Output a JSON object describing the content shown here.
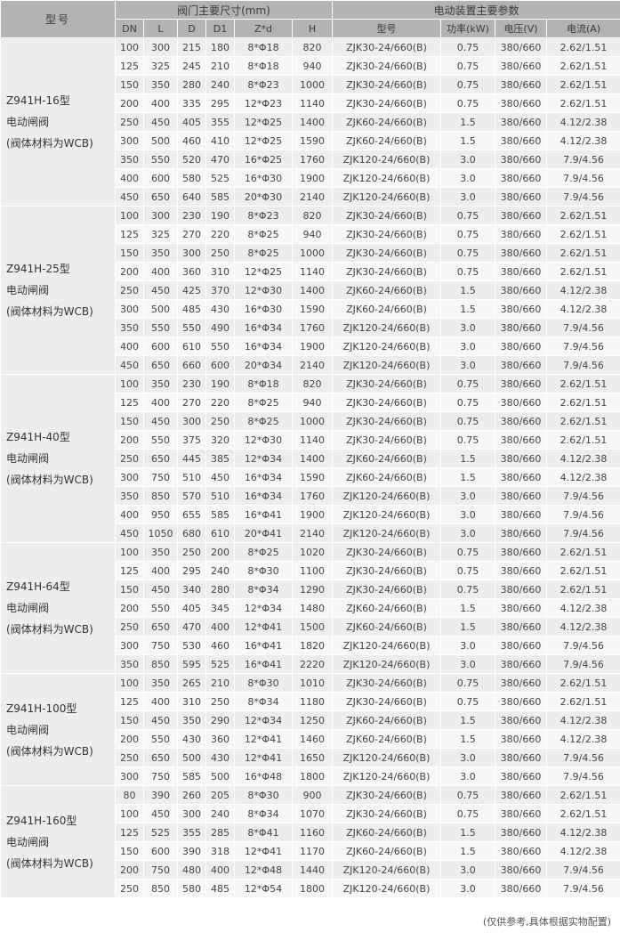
{
  "headers": {
    "model": "型号",
    "valve_group": "阀门主要尺寸(mm)",
    "actuator_group": "电动装置主要参数",
    "valve_cols": [
      "DN",
      "L",
      "D",
      "D1",
      "Z*d",
      "H"
    ],
    "actuator_cols": [
      "型号",
      "功率(kW)",
      "电压(V)",
      "电流(A)"
    ]
  },
  "groups": [
    {
      "model_lines": [
        "Z941H-16型",
        "电动闸阀",
        "(阀体材料为WCB)"
      ],
      "rows": [
        [
          "100",
          "300",
          "215",
          "180",
          "8*Φ18",
          "820",
          "ZJK30-24/660(B)",
          "0.75",
          "380/660",
          "2.62/1.51"
        ],
        [
          "125",
          "325",
          "245",
          "210",
          "8*Φ18",
          "940",
          "ZJK30-24/660(B)",
          "0.75",
          "380/660",
          "2.62/1.51"
        ],
        [
          "150",
          "350",
          "280",
          "240",
          "8*Φ23",
          "1000",
          "ZJK30-24/660(B)",
          "0.75",
          "380/660",
          "2.62/1.51"
        ],
        [
          "200",
          "400",
          "335",
          "295",
          "12*Φ23",
          "1140",
          "ZJK30-24/660(B)",
          "0.75",
          "380/660",
          "2.62/1.51"
        ],
        [
          "250",
          "450",
          "405",
          "355",
          "12*Φ25",
          "1400",
          "ZJK60-24/660(B)",
          "1.5",
          "380/660",
          "4.12/2.38"
        ],
        [
          "300",
          "500",
          "460",
          "410",
          "12*Φ25",
          "1590",
          "ZJK60-24/660(B)",
          "1.5",
          "380/660",
          "4.12/2.38"
        ],
        [
          "350",
          "550",
          "520",
          "470",
          "16*Φ25",
          "1760",
          "ZJK120-24/660(B)",
          "3.0",
          "380/660",
          "7.9/4.56"
        ],
        [
          "400",
          "600",
          "580",
          "525",
          "16*Φ30",
          "1900",
          "ZJK120-24/660(B)",
          "3.0",
          "380/660",
          "7.9/4.56"
        ],
        [
          "450",
          "650",
          "640",
          "585",
          "20*Φ30",
          "2140",
          "ZJK120-24/660(B)",
          "3.0",
          "380/660",
          "7.9/4.56"
        ]
      ]
    },
    {
      "model_lines": [
        "Z941H-25型",
        "电动闸阀",
        "(阀体材料为WCB)"
      ],
      "rows": [
        [
          "100",
          "300",
          "230",
          "190",
          "8*Φ23",
          "820",
          "ZJK30-24/660(B)",
          "0.75",
          "380/660",
          "2.62/1.51"
        ],
        [
          "125",
          "325",
          "270",
          "220",
          "8*Φ25",
          "940",
          "ZJK30-24/660(B)",
          "0.75",
          "380/660",
          "2.62/1.51"
        ],
        [
          "150",
          "350",
          "300",
          "250",
          "8*Φ25",
          "1000",
          "ZJK30-24/660(B)",
          "0.75",
          "380/660",
          "2.62/1.51"
        ],
        [
          "200",
          "400",
          "360",
          "310",
          "12*Φ25",
          "1140",
          "ZJK30-24/660(B)",
          "0.75",
          "380/660",
          "2.62/1.51"
        ],
        [
          "250",
          "450",
          "425",
          "370",
          "12*Φ30",
          "1400",
          "ZJK60-24/660(B)",
          "1.5",
          "380/660",
          "4.12/2.38"
        ],
        [
          "300",
          "500",
          "485",
          "430",
          "16*Φ30",
          "1590",
          "ZJK60-24/660(B)",
          "1.5",
          "380/660",
          "4.12/2.38"
        ],
        [
          "350",
          "550",
          "550",
          "490",
          "16*Φ34",
          "1760",
          "ZJK120-24/660(B)",
          "3.0",
          "380/660",
          "7.9/4.56"
        ],
        [
          "400",
          "600",
          "610",
          "550",
          "16*Φ34",
          "1900",
          "ZJK120-24/660(B)",
          "3.0",
          "380/660",
          "7.9/4.56"
        ],
        [
          "450",
          "650",
          "660",
          "600",
          "20*Φ34",
          "2140",
          "ZJK120-24/660(B)",
          "3.0",
          "380/660",
          "7.9/4.56"
        ]
      ]
    },
    {
      "model_lines": [
        "Z941H-40型",
        "电动闸阀",
        "(阀体材料为WCB)"
      ],
      "rows": [
        [
          "100",
          "350",
          "230",
          "190",
          "8*Φ18",
          "820",
          "ZJK30-24/660(B)",
          "0.75",
          "380/660",
          "2.62/1.51"
        ],
        [
          "125",
          "400",
          "270",
          "220",
          "8*Φ25",
          "940",
          "ZJK30-24/660(B)",
          "0.75",
          "380/660",
          "2.62/1.51"
        ],
        [
          "150",
          "450",
          "300",
          "250",
          "8*Φ25",
          "1000",
          "ZJK30-24/660(B)",
          "0.75",
          "380/660",
          "2.62/1.51"
        ],
        [
          "200",
          "550",
          "375",
          "320",
          "12*Φ30",
          "1140",
          "ZJK30-24/660(B)",
          "0.75",
          "380/660",
          "2.62/1.51"
        ],
        [
          "250",
          "650",
          "445",
          "385",
          "12*Φ34",
          "1400",
          "ZJK60-24/660(B)",
          "1.5",
          "380/660",
          "4.12/2.38"
        ],
        [
          "300",
          "750",
          "510",
          "450",
          "16*Φ34",
          "1590",
          "ZJK60-24/660(B)",
          "1.5",
          "380/660",
          "4.12/2.38"
        ],
        [
          "350",
          "850",
          "570",
          "510",
          "16*Φ34",
          "1760",
          "ZJK120-24/660(B)",
          "3.0",
          "380/660",
          "7.9/4.56"
        ],
        [
          "400",
          "950",
          "655",
          "585",
          "16*Φ41",
          "1900",
          "ZJK120-24/660(B)",
          "3.0",
          "380/660",
          "7.9/4.56"
        ],
        [
          "450",
          "1050",
          "680",
          "610",
          "20*Φ41",
          "2140",
          "ZJK120-24/660(B)",
          "3.0",
          "380/660",
          "7.9/4.56"
        ]
      ]
    },
    {
      "model_lines": [
        "Z941H-64型",
        "电动闸阀",
        "(阀体材料为WCB)"
      ],
      "rows": [
        [
          "100",
          "350",
          "250",
          "200",
          "8*Φ25",
          "1020",
          "ZJK30-24/660(B)",
          "0.75",
          "380/660",
          "2.62/1.51"
        ],
        [
          "125",
          "400",
          "295",
          "240",
          "8*Φ30",
          "1100",
          "ZJK30-24/660(B)",
          "0.75",
          "380/660",
          "2.62/1.51"
        ],
        [
          "150",
          "450",
          "340",
          "280",
          "8*Φ34",
          "1290",
          "ZJK30-24/660(B)",
          "0.75",
          "380/660",
          "2.62/1.51"
        ],
        [
          "200",
          "550",
          "405",
          "345",
          "12*Φ34",
          "1480",
          "ZJK60-24/660(B)",
          "1.5",
          "380/660",
          "4.12/2.38"
        ],
        [
          "250",
          "650",
          "470",
          "400",
          "12*Φ41",
          "1500",
          "ZJK60-24/660(B)",
          "1.5",
          "380/660",
          "4.12/2.38"
        ],
        [
          "300",
          "750",
          "530",
          "460",
          "16*Φ41",
          "1820",
          "ZJK120-24/660(B)",
          "3.0",
          "380/660",
          "7.9/4.56"
        ],
        [
          "350",
          "850",
          "595",
          "525",
          "16*Φ41",
          "2220",
          "ZJK120-24/660(B)",
          "3.0",
          "380/660",
          "7.9/4.56"
        ]
      ]
    },
    {
      "model_lines": [
        "Z941H-100型",
        "电动闸阀",
        "(阀体材料为WCB)"
      ],
      "rows": [
        [
          "100",
          "350",
          "265",
          "210",
          "8*Φ30",
          "1010",
          "ZJK30-24/660(B)",
          "0.75",
          "380/660",
          "2.62/1.51"
        ],
        [
          "125",
          "400",
          "310",
          "250",
          "8*Φ34",
          "1180",
          "ZJK30-24/660(B)",
          "0.75",
          "380/660",
          "2.62/1.51"
        ],
        [
          "150",
          "450",
          "350",
          "290",
          "12*Φ34",
          "1250",
          "ZJK60-24/660(B)",
          "1.5",
          "380/660",
          "4.12/2.38"
        ],
        [
          "200",
          "550",
          "430",
          "360",
          "12*Φ41",
          "1460",
          "ZJK60-24/660(B)",
          "1.5",
          "380/660",
          "4.12/2.38"
        ],
        [
          "250",
          "650",
          "500",
          "430",
          "12*Φ41",
          "1650",
          "ZJK120-24/660(B)",
          "3.0",
          "380/660",
          "7.9/4.56"
        ],
        [
          "300",
          "750",
          "585",
          "500",
          "16*Φ48",
          "1800",
          "ZJK120-24/660(B)",
          "3.0",
          "380/660",
          "7.9/4.56"
        ]
      ]
    },
    {
      "model_lines": [
        "Z941H-160型",
        "电动闸阀",
        "(阀体材料为WCB)"
      ],
      "rows": [
        [
          "80",
          "390",
          "260",
          "205",
          "8*Φ30",
          "900",
          "ZJK30-24/660(B)",
          "0.75",
          "380/660",
          "2.62/1.51"
        ],
        [
          "100",
          "450",
          "300",
          "240",
          "8*Φ34",
          "1070",
          "ZJK30-24/660(B)",
          "0.75",
          "380/660",
          "2.62/1.51"
        ],
        [
          "125",
          "525",
          "355",
          "285",
          "8*Φ41",
          "1160",
          "ZJK60-24/660(B)",
          "1.5",
          "380/660",
          "4.12/2.38"
        ],
        [
          "150",
          "600",
          "390",
          "318",
          "12*Φ41",
          "1170",
          "ZJK60-24/660(B)",
          "1.5",
          "380/660",
          "4.12/2.38"
        ],
        [
          "200",
          "750",
          "480",
          "400",
          "12*Φ48",
          "1440",
          "ZJK120-24/660(B)",
          "3.0",
          "380/660",
          "7.9/4.56"
        ],
        [
          "250",
          "850",
          "580",
          "485",
          "12*Φ54",
          "1800",
          "ZJK120-24/660(B)",
          "3.0",
          "380/660",
          "7.9/4.56"
        ]
      ]
    }
  ],
  "footnote": "(仅供参考,具体根据实物配置)"
}
